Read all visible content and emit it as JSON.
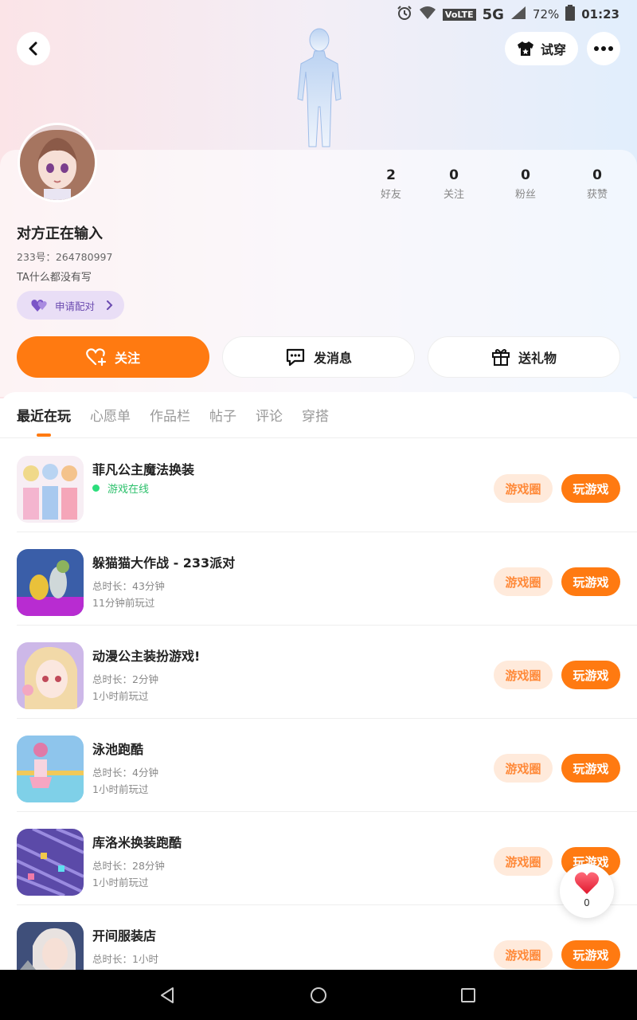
{
  "status_bar": {
    "battery": "72%",
    "time": "01:23",
    "network": "5G",
    "volte": "VoLTE"
  },
  "header": {
    "tryon_label": "试穿"
  },
  "profile": {
    "stats": [
      {
        "num": "2",
        "label": "好友"
      },
      {
        "num": "0",
        "label": "关注"
      },
      {
        "num": "0",
        "label": "粉丝"
      },
      {
        "num": "0",
        "label": "获赞"
      }
    ],
    "username": "对方正在输入",
    "user_id": "233号：264780997",
    "bio": "TA什么都没有写",
    "match_label": "申请配对"
  },
  "actions": {
    "follow": "关注",
    "message": "发消息",
    "gift": "送礼物"
  },
  "tabs": [
    "最近在玩",
    "心愿单",
    "作品栏",
    "帖子",
    "评论",
    "穿搭"
  ],
  "games": [
    {
      "name": "菲凡公主魔法换装",
      "status": "游戏在线",
      "duration": "",
      "last": ""
    },
    {
      "name": "躲猫猫大作战 - 233派对",
      "status": "",
      "duration": "总时长：43分钟",
      "last": "11分钟前玩过"
    },
    {
      "name": "动漫公主装扮游戏!",
      "status": "",
      "duration": "总时长：2分钟",
      "last": "1小时前玩过"
    },
    {
      "name": "泳池跑酷",
      "status": "",
      "duration": "总时长：4分钟",
      "last": "1小时前玩过"
    },
    {
      "name": "库洛米换装跑酷",
      "status": "",
      "duration": "总时长：28分钟",
      "last": "1小时前玩过"
    },
    {
      "name": "开间服装店",
      "status": "",
      "duration": "总时长：1小时",
      "last": ""
    }
  ],
  "game_buttons": {
    "circle": "游戏圈",
    "play": "玩游戏"
  },
  "like_float": {
    "count": "0"
  },
  "colors": {
    "accent": "#ff7a11",
    "online": "#2cc06b",
    "match": "#6b4bb0"
  }
}
